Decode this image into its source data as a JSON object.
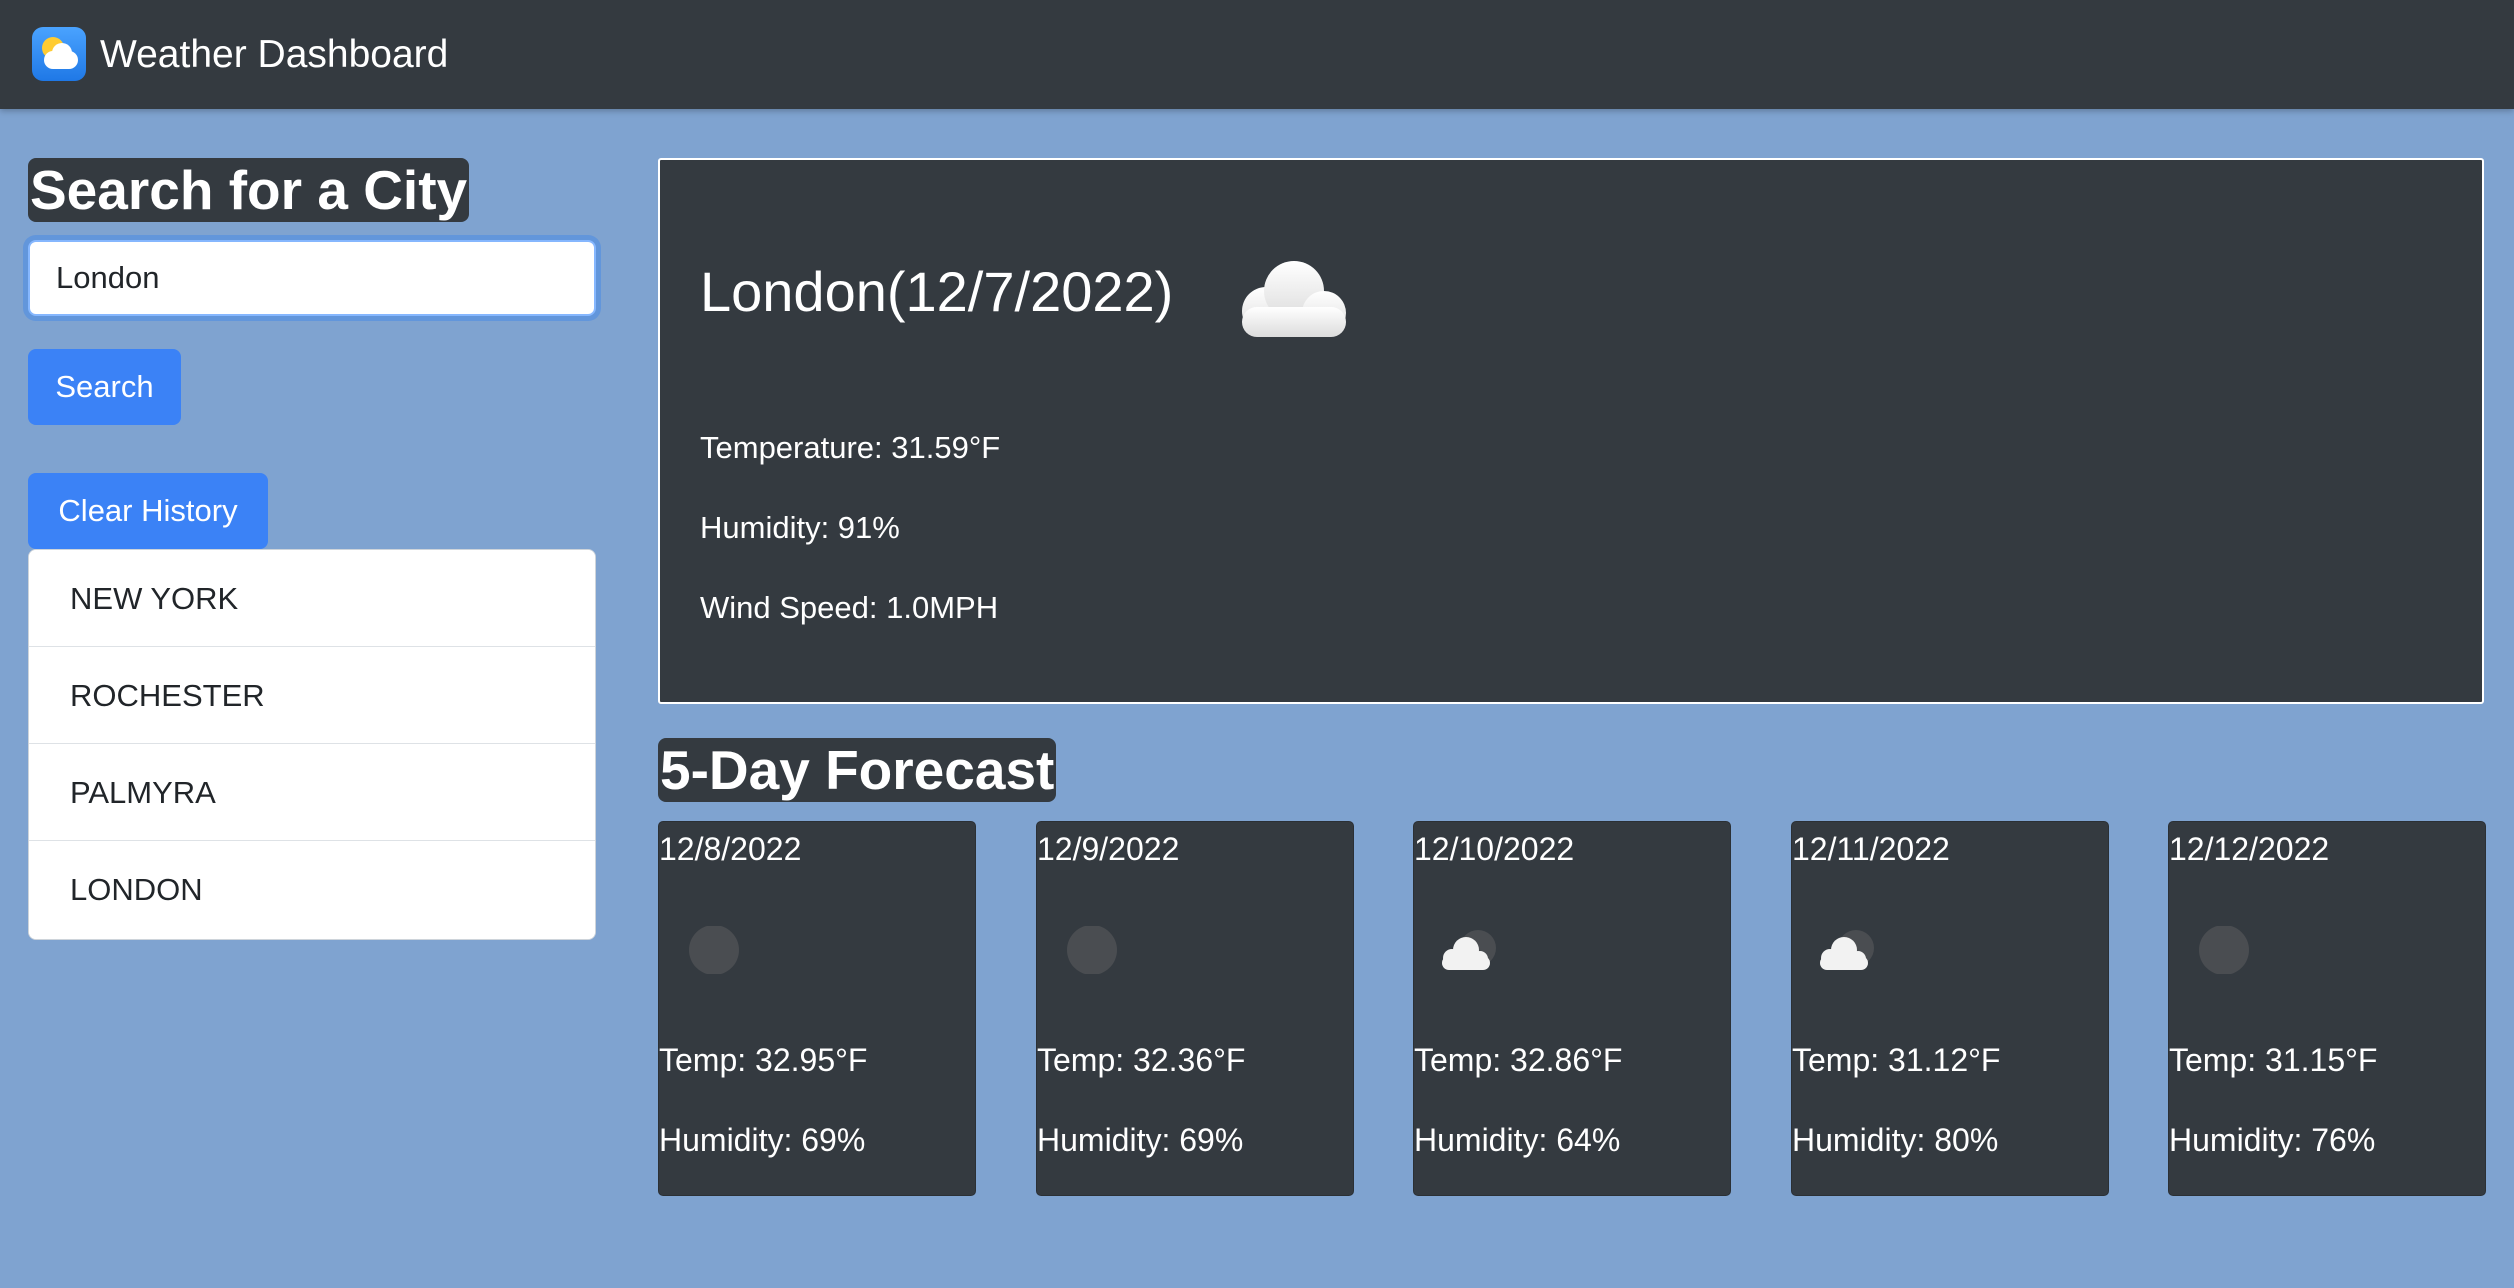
{
  "navbar": {
    "title": "Weather Dashboard",
    "icon": "weather-app-icon"
  },
  "search": {
    "heading": "Search for a City",
    "input_value": "London",
    "search_label": "Search",
    "clear_label": "Clear History",
    "history": [
      "NEW YORK",
      "ROCHESTER",
      "PALMYRA",
      "LONDON"
    ]
  },
  "current": {
    "title": "London(12/7/2022)",
    "icon": "cloud-icon",
    "temperature": "Temperature: 31.59°F",
    "humidity": "Humidity: 91%",
    "wind": "Wind Speed: 1.0MPH"
  },
  "forecast": {
    "heading": "5-Day Forecast",
    "days": [
      {
        "date": "12/8/2022",
        "icon": "clear-night-icon",
        "temp": "Temp: 32.95°F",
        "humidity": "Humidity: 69%"
      },
      {
        "date": "12/9/2022",
        "icon": "clear-night-icon",
        "temp": "Temp: 32.36°F",
        "humidity": "Humidity: 69%"
      },
      {
        "date": "12/10/2022",
        "icon": "cloudy-night-icon",
        "temp": "Temp: 32.86°F",
        "humidity": "Humidity: 64%"
      },
      {
        "date": "12/11/2022",
        "icon": "cloudy-night-icon",
        "temp": "Temp: 31.12°F",
        "humidity": "Humidity: 80%"
      },
      {
        "date": "12/12/2022",
        "icon": "clear-night-icon",
        "temp": "Temp: 31.15°F",
        "humidity": "Humidity: 76%"
      }
    ]
  },
  "colors": {
    "background": "#7fa3d0",
    "panel": "#343a40",
    "primary": "#3b82f6"
  }
}
